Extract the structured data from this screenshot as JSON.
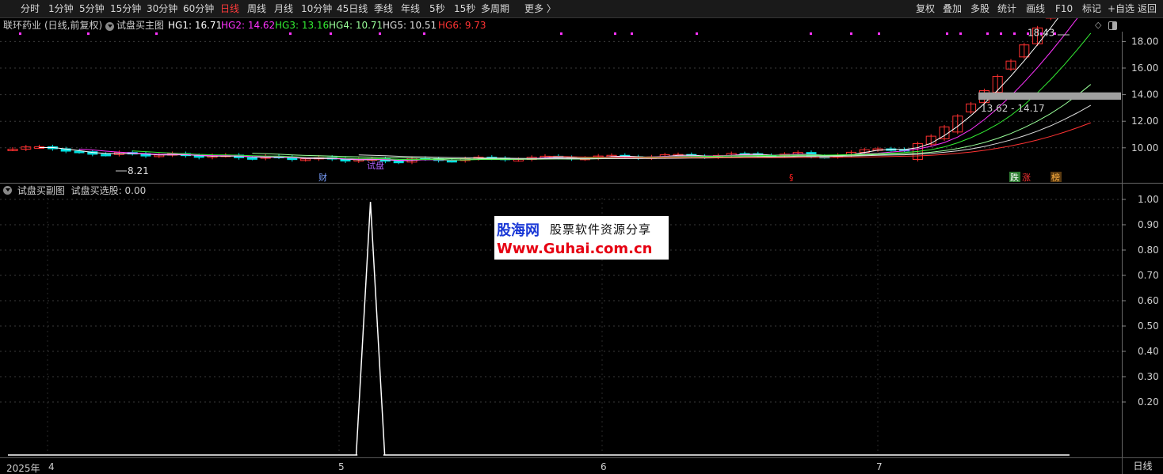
{
  "toolbar": {
    "period_tabs": [
      "分时",
      "1分钟",
      "5分钟",
      "15分钟",
      "30分钟",
      "60分钟",
      "日线",
      "周线",
      "月线",
      "10分钟",
      "45日线",
      "季线",
      "年线",
      "5秒",
      "15秒",
      "多周期",
      "更多 〉"
    ],
    "active_tab": "日线",
    "right_tools": [
      "复权",
      "叠加",
      "多股",
      "统计",
      "画线",
      "F10",
      "标记",
      "+自选",
      "返回"
    ]
  },
  "main_header": {
    "stock_name": "联环药业",
    "mode": "(日线,前复权)",
    "indicator_name": "试盘买主图",
    "values": [
      {
        "label": "HG1:",
        "value": "16.71",
        "color": "#ffffff"
      },
      {
        "label": "HG2:",
        "value": "14.62",
        "color": "#ff33ff"
      },
      {
        "label": "HG3:",
        "value": "13.16",
        "color": "#33ee33"
      },
      {
        "label": "HG4:",
        "value": "10.71",
        "color": "#99ff99"
      },
      {
        "label": "HG5:",
        "value": "10.51",
        "color": "#dddddd"
      },
      {
        "label": "HG6:",
        "value": "9.73",
        "color": "#ff3333"
      }
    ]
  },
  "sub_header": {
    "indicator_name": "试盘买副图",
    "value_label": "试盘买选股: 0.00"
  },
  "main_axis": {
    "ticks": [
      "18.00",
      "16.00",
      "14.00",
      "12.00",
      "10.00"
    ],
    "values": [
      18,
      16,
      14,
      12,
      10
    ]
  },
  "sub_axis": {
    "ticks": [
      "1.00",
      "0.90",
      "0.80",
      "0.70",
      "0.60",
      "0.50",
      "0.40",
      "0.30",
      "0.20"
    ],
    "values": [
      1.0,
      0.9,
      0.8,
      0.7,
      0.6,
      0.5,
      0.4,
      0.3,
      0.2
    ]
  },
  "annotations": {
    "high_label": "18.43",
    "low_label": "8.21",
    "band_label": "13.62 - 14.17",
    "band_low": 13.62,
    "band_high": 14.17,
    "markers": [
      "财",
      "试盘",
      "§",
      "跌",
      "涨",
      "榜"
    ]
  },
  "x_axis": {
    "year_label": "2025年",
    "months": [
      "4",
      "5",
      "6",
      "7"
    ]
  },
  "period_indicator": "日线",
  "colors": {
    "up": "#ff3030",
    "down": "#00e0e0",
    "grid": "#3a3a3a",
    "dot": "#ff33ff"
  },
  "chart_data": {
    "type": "line",
    "series": [
      {
        "values": [
          0,
          0,
          0,
          0,
          0,
          0,
          0,
          0,
          0,
          0,
          0,
          0,
          0,
          0,
          0,
          0,
          0,
          0,
          0,
          0,
          0,
          0,
          0,
          0,
          0,
          0,
          0,
          0,
          1,
          0,
          0,
          0,
          0,
          0,
          0,
          0,
          0,
          0,
          0,
          0,
          0,
          0,
          0,
          0,
          0,
          0,
          0,
          0,
          0,
          0,
          0,
          0,
          0,
          0,
          0,
          0,
          0,
          0,
          0,
          0,
          0,
          0,
          0,
          0,
          0,
          0,
          0,
          0,
          0,
          0,
          0,
          0,
          0,
          0,
          0,
          0,
          0,
          0,
          0,
          0,
          0,
          0,
          0
        ]
      }
    ],
    "ylim": [
      0,
      1.0
    ]
  }
}
